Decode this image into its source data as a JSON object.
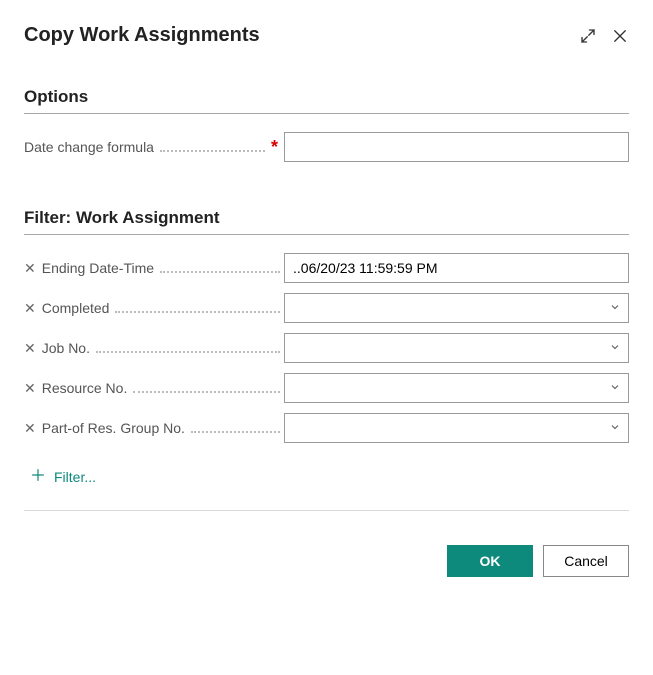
{
  "header": {
    "title": "Copy Work Assignments"
  },
  "options": {
    "heading": "Options",
    "date_change_formula": {
      "label": "Date change formula",
      "value": ""
    }
  },
  "filter": {
    "heading": "Filter: Work Assignment",
    "rows": [
      {
        "label": "Ending Date-Time",
        "value": "..06/20/23 11:59:59 PM",
        "dropdown": false
      },
      {
        "label": "Completed",
        "value": "",
        "dropdown": true
      },
      {
        "label": "Job No.",
        "value": "",
        "dropdown": true
      },
      {
        "label": "Resource No.",
        "value": "",
        "dropdown": true
      },
      {
        "label": "Part-of Res. Group No.",
        "value": "",
        "dropdown": true
      }
    ],
    "add_filter_label": "Filter..."
  },
  "footer": {
    "ok": "OK",
    "cancel": "Cancel"
  }
}
